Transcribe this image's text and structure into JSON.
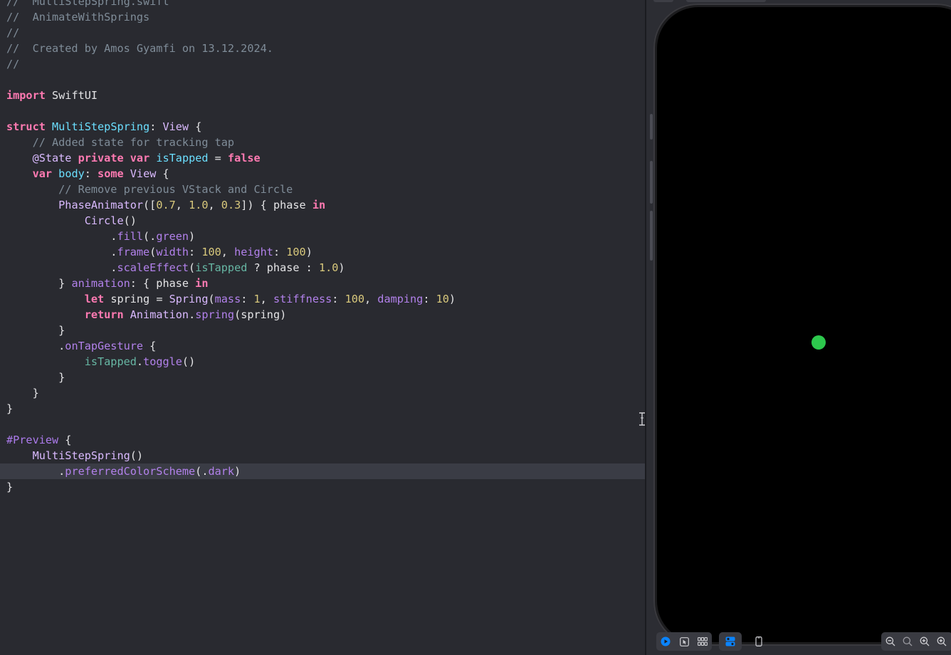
{
  "editor": {
    "lines": [
      [
        {
          "c": "t-com",
          "t": "//  MultiStepSpring.swift"
        }
      ],
      [
        {
          "c": "t-com",
          "t": "//  AnimateWithSprings"
        }
      ],
      [
        {
          "c": "t-com",
          "t": "//"
        }
      ],
      [
        {
          "c": "t-com",
          "t": "//  Created by Amos Gyamfi on 13.12.2024."
        }
      ],
      [
        {
          "c": "t-com",
          "t": "//"
        }
      ],
      [],
      [
        {
          "c": "t-kw",
          "t": "import"
        },
        {
          "c": "t-pl",
          "t": " SwiftUI"
        }
      ],
      [],
      [
        {
          "c": "t-kw",
          "t": "struct"
        },
        {
          "c": "t-pl",
          "t": " "
        },
        {
          "c": "t-decl",
          "t": "MultiStepSpring"
        },
        {
          "c": "t-pl",
          "t": ": "
        },
        {
          "c": "t-type",
          "t": "View"
        },
        {
          "c": "t-pl",
          "t": " {"
        }
      ],
      [
        {
          "c": "t-pl",
          "t": "    "
        },
        {
          "c": "t-com",
          "t": "// Added state for tracking tap"
        }
      ],
      [
        {
          "c": "t-pl",
          "t": "    "
        },
        {
          "c": "t-type",
          "t": "@State"
        },
        {
          "c": "t-pl",
          "t": " "
        },
        {
          "c": "t-kw",
          "t": "private"
        },
        {
          "c": "t-pl",
          "t": " "
        },
        {
          "c": "t-kw",
          "t": "var"
        },
        {
          "c": "t-pl",
          "t": " "
        },
        {
          "c": "t-decl",
          "t": "isTapped"
        },
        {
          "c": "t-pl",
          "t": " = "
        },
        {
          "c": "t-kw",
          "t": "false"
        }
      ],
      [
        {
          "c": "t-pl",
          "t": "    "
        },
        {
          "c": "t-kw",
          "t": "var"
        },
        {
          "c": "t-pl",
          "t": " "
        },
        {
          "c": "t-decl",
          "t": "body"
        },
        {
          "c": "t-pl",
          "t": ": "
        },
        {
          "c": "t-kw",
          "t": "some"
        },
        {
          "c": "t-pl",
          "t": " "
        },
        {
          "c": "t-type",
          "t": "View"
        },
        {
          "c": "t-pl",
          "t": " {"
        }
      ],
      [
        {
          "c": "t-pl",
          "t": "        "
        },
        {
          "c": "t-com",
          "t": "// Remove previous VStack and Circle"
        }
      ],
      [
        {
          "c": "t-pl",
          "t": "        "
        },
        {
          "c": "t-type",
          "t": "PhaseAnimator"
        },
        {
          "c": "t-pl",
          "t": "(["
        },
        {
          "c": "t-num",
          "t": "0.7"
        },
        {
          "c": "t-pl",
          "t": ", "
        },
        {
          "c": "t-num",
          "t": "1.0"
        },
        {
          "c": "t-pl",
          "t": ", "
        },
        {
          "c": "t-num",
          "t": "0.3"
        },
        {
          "c": "t-pl",
          "t": "]) { phase "
        },
        {
          "c": "t-kw",
          "t": "in"
        }
      ],
      [
        {
          "c": "t-pl",
          "t": "            "
        },
        {
          "c": "t-type",
          "t": "Circle"
        },
        {
          "c": "t-pl",
          "t": "()"
        }
      ],
      [
        {
          "c": "t-pl",
          "t": "                ."
        },
        {
          "c": "t-call",
          "t": "fill"
        },
        {
          "c": "t-pl",
          "t": "(."
        },
        {
          "c": "t-call",
          "t": "green"
        },
        {
          "c": "t-pl",
          "t": ")"
        }
      ],
      [
        {
          "c": "t-pl",
          "t": "                ."
        },
        {
          "c": "t-call",
          "t": "frame"
        },
        {
          "c": "t-pl",
          "t": "("
        },
        {
          "c": "t-call",
          "t": "width"
        },
        {
          "c": "t-pl",
          "t": ": "
        },
        {
          "c": "t-num",
          "t": "100"
        },
        {
          "c": "t-pl",
          "t": ", "
        },
        {
          "c": "t-call",
          "t": "height"
        },
        {
          "c": "t-pl",
          "t": ": "
        },
        {
          "c": "t-num",
          "t": "100"
        },
        {
          "c": "t-pl",
          "t": ")"
        }
      ],
      [
        {
          "c": "t-pl",
          "t": "                ."
        },
        {
          "c": "t-call",
          "t": "scaleEffect"
        },
        {
          "c": "t-pl",
          "t": "("
        },
        {
          "c": "t-id",
          "t": "isTapped"
        },
        {
          "c": "t-pl",
          "t": " ? phase : "
        },
        {
          "c": "t-num",
          "t": "1.0"
        },
        {
          "c": "t-pl",
          "t": ")"
        }
      ],
      [
        {
          "c": "t-pl",
          "t": "        } "
        },
        {
          "c": "t-call",
          "t": "animation"
        },
        {
          "c": "t-pl",
          "t": ": { phase "
        },
        {
          "c": "t-kw",
          "t": "in"
        }
      ],
      [
        {
          "c": "t-pl",
          "t": "            "
        },
        {
          "c": "t-kw",
          "t": "let"
        },
        {
          "c": "t-pl",
          "t": " spring = "
        },
        {
          "c": "t-type",
          "t": "Spring"
        },
        {
          "c": "t-pl",
          "t": "("
        },
        {
          "c": "t-call",
          "t": "mass"
        },
        {
          "c": "t-pl",
          "t": ": "
        },
        {
          "c": "t-num",
          "t": "1"
        },
        {
          "c": "t-pl",
          "t": ", "
        },
        {
          "c": "t-call",
          "t": "stiffness"
        },
        {
          "c": "t-pl",
          "t": ": "
        },
        {
          "c": "t-num",
          "t": "100"
        },
        {
          "c": "t-pl",
          "t": ", "
        },
        {
          "c": "t-call",
          "t": "damping"
        },
        {
          "c": "t-pl",
          "t": ": "
        },
        {
          "c": "t-num",
          "t": "10"
        },
        {
          "c": "t-pl",
          "t": ")"
        }
      ],
      [
        {
          "c": "t-pl",
          "t": "            "
        },
        {
          "c": "t-kw",
          "t": "return"
        },
        {
          "c": "t-pl",
          "t": " "
        },
        {
          "c": "t-type",
          "t": "Animation"
        },
        {
          "c": "t-pl",
          "t": "."
        },
        {
          "c": "t-call",
          "t": "spring"
        },
        {
          "c": "t-pl",
          "t": "(spring)"
        }
      ],
      [
        {
          "c": "t-pl",
          "t": "        }"
        }
      ],
      [
        {
          "c": "t-pl",
          "t": "        ."
        },
        {
          "c": "t-call",
          "t": "onTapGesture"
        },
        {
          "c": "t-pl",
          "t": " {"
        }
      ],
      [
        {
          "c": "t-pl",
          "t": "            "
        },
        {
          "c": "t-id",
          "t": "isTapped"
        },
        {
          "c": "t-pl",
          "t": "."
        },
        {
          "c": "t-call",
          "t": "toggle"
        },
        {
          "c": "t-pl",
          "t": "()"
        }
      ],
      [
        {
          "c": "t-pl",
          "t": "        }"
        }
      ],
      [
        {
          "c": "t-pl",
          "t": "    }"
        }
      ],
      [
        {
          "c": "t-pl",
          "t": "}"
        }
      ],
      [],
      [
        {
          "c": "t-prev",
          "t": "#Preview"
        },
        {
          "c": "t-pl",
          "t": " {"
        }
      ],
      [
        {
          "c": "t-pl",
          "t": "    "
        },
        {
          "c": "t-type",
          "t": "MultiStepSpring"
        },
        {
          "c": "t-pl",
          "t": "()"
        }
      ],
      [
        {
          "c": "t-pl",
          "t": "        ."
        },
        {
          "c": "t-call",
          "t": "preferredColorScheme"
        },
        {
          "c": "t-pl",
          "t": "(."
        },
        {
          "c": "t-call",
          "t": "dark"
        },
        {
          "c": "t-pl",
          "t": ")"
        }
      ],
      [
        {
          "c": "t-pl",
          "t": "}"
        }
      ]
    ],
    "highlighted_line": 30
  },
  "preview": {
    "circle_color": "#2dc84d",
    "screen_color": "#000000",
    "toolbar": {
      "live_icon": "play-circle-icon",
      "selectable_icon": "cursor-arrow-icon",
      "variants_icon": "grid-icon",
      "device_settings_icon": "device-settings-icon",
      "device_icon": "iphone-icon",
      "zoom_out_icon": "zoom-out-icon",
      "zoom_actual_icon": "zoom-actual-icon",
      "zoom_in_icon": "zoom-in-icon",
      "zoom_fit_icon": "zoom-fit-icon"
    }
  },
  "colors": {
    "editor_bg": "#292a30",
    "keyword": "#ff7ab2",
    "comment": "#7f8c98",
    "type": "#dabaff",
    "number": "#d9c97c",
    "accent_blue": "#0a84ff"
  }
}
